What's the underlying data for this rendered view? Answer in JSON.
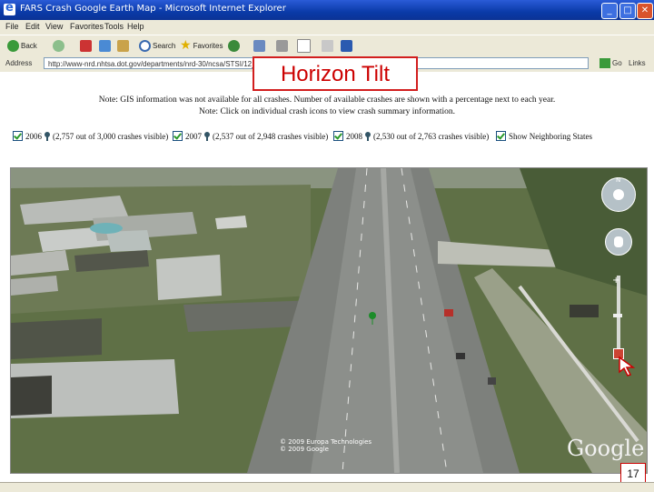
{
  "window": {
    "title": "FARS Crash Google Earth Map - Microsoft Internet Explorer",
    "minimize": "_",
    "maximize": "□",
    "close": "✕"
  },
  "menu": [
    "File",
    "Edit",
    "View",
    "Favorites",
    "Tools",
    "Help"
  ],
  "toolbar": {
    "back": "Back",
    "search": "Search",
    "favorites": "Favorites"
  },
  "address": {
    "label": "Address",
    "url": "http://www-nrd.nhtsa.dot.gov/departments/nrd-30/ncsa/STSI/12_FL/2008/",
    "go": "Go",
    "links": "Links"
  },
  "overlay": {
    "title": "Horizon Tilt",
    "page_number": "17"
  },
  "notes": {
    "line1": "Note: GIS information was not available for all crashes. Number of available crashes are shown with a percentage next to each year.",
    "line2": "Note: Click on individual crash icons to view crash summary information."
  },
  "years": [
    {
      "year": "2006",
      "text": "(2,757 out of 3,000 crashes visible)"
    },
    {
      "year": "2007",
      "text": "(2,537 out of 2,948 crashes visible)"
    },
    {
      "year": "2008",
      "text": "(2,530 out of 2,763 crashes visible)"
    }
  ],
  "neighbors": {
    "label": "Show Neighboring States"
  },
  "map": {
    "copyright1": "© 2009 Europa Technologies",
    "copyright2": "© 2009 Google",
    "logo": "Google",
    "compass_north": "N"
  },
  "colors": {
    "overlay_border": "#d21e1e",
    "overlay_text": "#cc0000",
    "checkmark": "#2a9a2a"
  }
}
